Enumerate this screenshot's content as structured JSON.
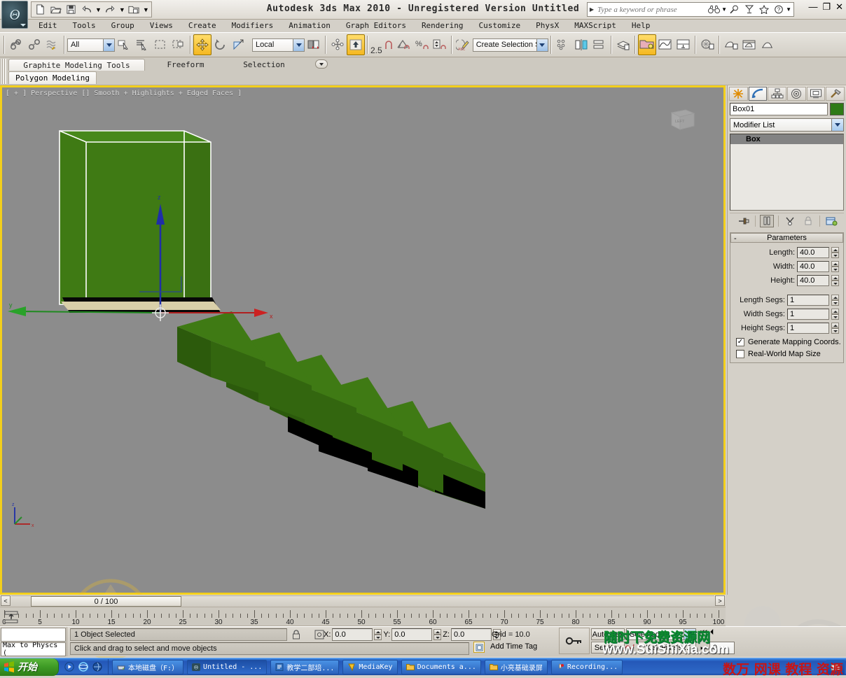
{
  "app": {
    "title": "Autodesk 3ds Max  2010  -  Unregistered Version  Untitled",
    "logo_glyph": "Θ"
  },
  "quick_access": {
    "items": [
      {
        "name": "new-file-icon",
        "glyph": "▢"
      },
      {
        "name": "open-file-icon",
        "glyph": "▱"
      },
      {
        "name": "save-file-icon",
        "glyph": "▣"
      },
      {
        "name": "undo-icon",
        "glyph": "↶"
      },
      {
        "name": "redo-icon",
        "glyph": "↷"
      },
      {
        "name": "set-project-folder-icon",
        "glyph": "▤"
      }
    ]
  },
  "search": {
    "placeholder": "Type a keyword or phrase",
    "icons": [
      "binoculars-icon",
      "magnifier-icon",
      "subscription-icon",
      "favorites-star-icon",
      "help-question-icon"
    ]
  },
  "window_buttons": {
    "minimize": "—",
    "restore": "❐",
    "close": "✕"
  },
  "menu": {
    "items": [
      "Edit",
      "Tools",
      "Group",
      "Views",
      "Create",
      "Modifiers",
      "Animation",
      "Graph Editors",
      "Rendering",
      "Customize",
      "PhysX",
      "MAXScript",
      "Help"
    ]
  },
  "toolbar": {
    "selection_filter": "All",
    "reference_coord_system": "Local",
    "named_selection_sets": "Create Selection Set",
    "angle_snap_value": "2.5",
    "percent_label": "%",
    "buttons": [
      {
        "name": "select-and-link-icon"
      },
      {
        "name": "unlink-selection-icon"
      },
      {
        "name": "bind-to-space-warp-icon"
      },
      {
        "name": "select-object-icon"
      },
      {
        "name": "select-by-name-icon"
      },
      {
        "name": "rectangular-selection-region-icon"
      },
      {
        "name": "window-crossing-icon"
      },
      {
        "name": "select-and-move-icon"
      },
      {
        "name": "select-and-rotate-icon"
      },
      {
        "name": "select-and-scale-icon"
      },
      {
        "name": "use-pivot-point-center-icon"
      },
      {
        "name": "snaps-toggle-icon"
      },
      {
        "name": "angle-snap-toggle-icon"
      },
      {
        "name": "percent-snap-toggle-icon"
      },
      {
        "name": "spinner-snap-toggle-icon"
      },
      {
        "name": "edit-named-selection-sets-icon"
      },
      {
        "name": "mirror-icon"
      },
      {
        "name": "align-icon"
      },
      {
        "name": "layer-manager-icon"
      },
      {
        "name": "graphite-modeling-toggle-icon"
      },
      {
        "name": "curve-editor-icon"
      },
      {
        "name": "schematic-view-icon"
      },
      {
        "name": "material-editor-icon"
      },
      {
        "name": "render-setup-icon"
      },
      {
        "name": "rendered-frame-window-icon"
      },
      {
        "name": "render-production-icon"
      }
    ]
  },
  "ribbon": {
    "tabs": [
      {
        "label": "Graphite Modeling Tools",
        "selected": true
      },
      {
        "label": "Freeform",
        "selected": false
      },
      {
        "label": "Selection",
        "selected": false
      }
    ],
    "subtab": "Polygon Modeling"
  },
  "viewport": {
    "label": "[ + ] Perspective [] Smooth + Highlights + Edged Faces ]",
    "viewcube_face": "LEFT",
    "axis_labels": {
      "x": "x",
      "y": "y",
      "z": "z"
    },
    "object_color": "#3f7a14",
    "object_color_dark": "#2e5c0e",
    "background": "#8c8c8c"
  },
  "command_panel": {
    "tabs": [
      {
        "name": "create-tab",
        "selected": false
      },
      {
        "name": "modify-tab",
        "selected": true
      },
      {
        "name": "hierarchy-tab",
        "selected": false
      },
      {
        "name": "motion-tab",
        "selected": false
      },
      {
        "name": "display-tab",
        "selected": false
      },
      {
        "name": "utilities-tab",
        "selected": false
      }
    ],
    "object_name": "Box01",
    "object_color": "#2f7a16",
    "modifier_list": "Modifier List",
    "modifier_stack": [
      "Box"
    ],
    "stack_buttons": [
      {
        "name": "pin-stack-icon",
        "pressed": false
      },
      {
        "name": "show-end-result-icon",
        "pressed": true
      },
      {
        "name": "make-unique-icon",
        "pressed": false
      },
      {
        "name": "remove-modifier-icon",
        "pressed": false
      },
      {
        "name": "configure-modifier-sets-icon",
        "pressed": false
      }
    ],
    "rollout": {
      "title": "Parameters",
      "collapse_glyph": "-",
      "fields": [
        {
          "label": "Length:",
          "value": "40.0"
        },
        {
          "label": "Width:",
          "value": "40.0"
        },
        {
          "label": "Height:",
          "value": "40.0"
        }
      ],
      "segs": [
        {
          "label": "Length Segs:",
          "value": "1"
        },
        {
          "label": "Width Segs:",
          "value": "1"
        },
        {
          "label": "Height Segs:",
          "value": "1"
        }
      ],
      "checkboxes": [
        {
          "label": "Generate Mapping Coords.",
          "checked": true
        },
        {
          "label": "Real-World Map Size",
          "checked": false
        }
      ]
    }
  },
  "time_slider": {
    "current": "0 / 100",
    "prev_glyph": "<",
    "next_glyph": ">"
  },
  "ruler": {
    "min": 0,
    "max": 100,
    "label_step": 5,
    "labels": [
      0,
      5,
      10,
      15,
      20,
      25,
      30,
      35,
      40,
      45,
      50,
      55,
      60,
      65,
      70,
      75,
      80,
      85,
      90,
      95,
      100
    ]
  },
  "status_bar": {
    "maxscript_listener_top": "",
    "maxscript_listener_bottom": "Max to Physcs (",
    "selection_status": "1 Object Selected",
    "prompt": "Click and drag to select and move objects",
    "lock_icon": "selection-lock-icon",
    "coord_icon": "absolute-mode-transform-icon",
    "coords": [
      {
        "label": "X:",
        "value": "0.0"
      },
      {
        "label": "Y:",
        "value": "0.0"
      },
      {
        "label": "Z:",
        "value": "0.0"
      }
    ],
    "grid": "Grid = 10.0",
    "add_time_tag": "Add Time Tag"
  },
  "animation_controls": {
    "key_mode_icon": "key-mode-toggle-icon",
    "auto_key": "Auto Key",
    "set_key": "Set Key",
    "filter_selected": "Selected",
    "key_filters": "Key Filters...",
    "frame_value": "0",
    "playback": [
      {
        "name": "go-to-start-icon",
        "glyph": "⏮"
      },
      {
        "name": "previous-frame-icon",
        "glyph": "⏴"
      },
      {
        "name": "go-to-end-icon",
        "glyph": "⏭"
      }
    ]
  },
  "taskbar": {
    "start_label": "开始",
    "quick_launch": [
      "media-player-icon",
      "internet-explorer-icon",
      "browser-icon"
    ],
    "items": [
      {
        "label": "本地磁盘（F:）",
        "icon": "drive-icon",
        "active": false
      },
      {
        "label": "Untitled - ...",
        "icon": "max-icon",
        "active": true
      },
      {
        "label": "教学二部培...",
        "icon": "doc-icon",
        "active": false
      },
      {
        "label": "MediaKey",
        "icon": "mediakey-icon",
        "active": false
      },
      {
        "label": "Documents a...",
        "icon": "folder-icon",
        "active": false
      },
      {
        "label": "小亮基础录屏",
        "icon": "folder-icon",
        "active": false
      },
      {
        "label": "Recording...",
        "icon": "record-icon",
        "active": false
      }
    ]
  },
  "watermarks": [
    {
      "text": "随时下免费资源网",
      "color": "#0f8a2f"
    },
    {
      "text": "www.SuiShiXia.com",
      "color": "#ffffff"
    },
    {
      "text": "数万 网课 教程 资源",
      "color": "#c81414"
    }
  ]
}
